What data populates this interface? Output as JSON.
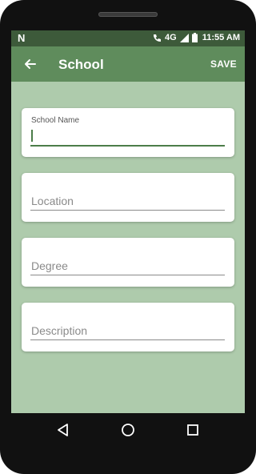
{
  "status_bar": {
    "notification_icon": "n-icon",
    "network": "4G",
    "time": "11:55 AM"
  },
  "app_bar": {
    "title": "School",
    "save_label": "SAVE",
    "back_icon": "arrow-left-icon"
  },
  "form": {
    "school_name_label": "School Name",
    "school_name_value": "",
    "location_placeholder": "Location",
    "degree_placeholder": "Degree",
    "description_placeholder": "Description"
  },
  "colors": {
    "app_bar": "#5f8c5c",
    "status_bar": "#3d5a3a",
    "background": "#aecbac",
    "accent": "#4c7d49"
  },
  "nav_bar": {
    "icons": [
      "back-triangle-icon",
      "home-circle-icon",
      "recents-square-icon"
    ]
  }
}
